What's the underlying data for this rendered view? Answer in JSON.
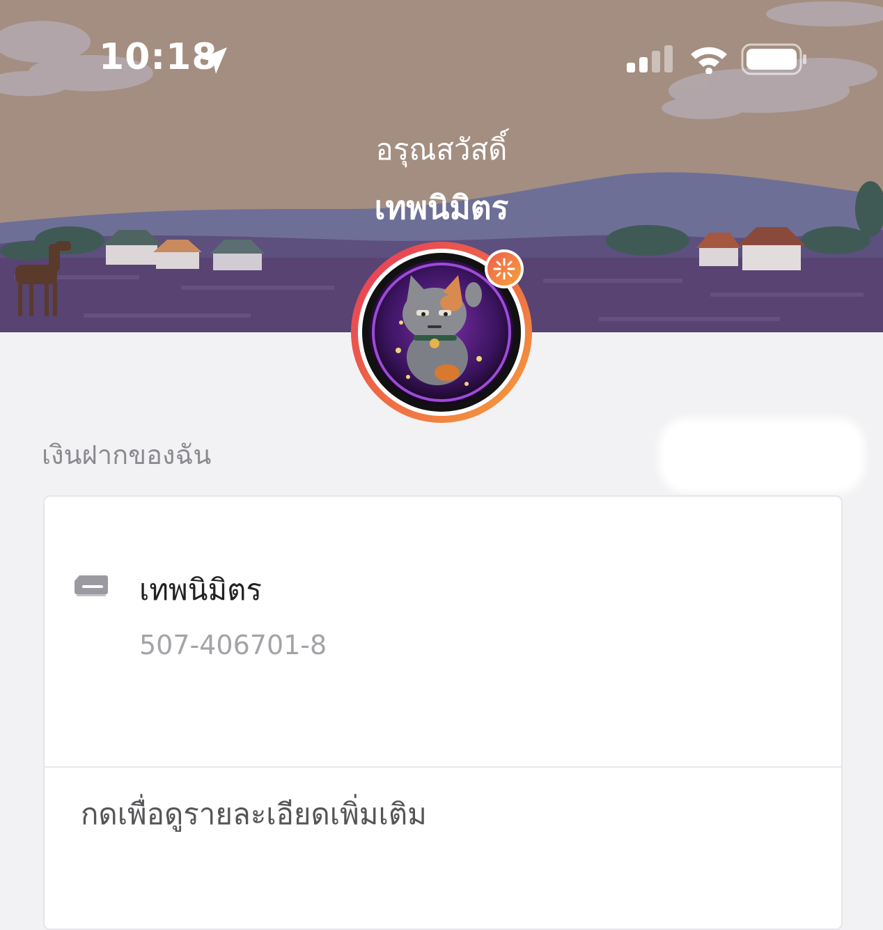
{
  "status_bar": {
    "time": "10:18",
    "icons": [
      "location-arrow-icon",
      "cellular-signal-icon",
      "wifi-icon",
      "battery-icon"
    ]
  },
  "header": {
    "greeting": "อรุณสวัสดิ์",
    "user_name": "เทพนิมิตร",
    "avatar": "lucky-cat-avatar",
    "avatar_badge_icon": "sparkle-badge-icon"
  },
  "section": {
    "title": "เงินฝากของฉัน"
  },
  "account_card": {
    "icon": "bank-card-icon",
    "account_name": "เทพนิมิตร",
    "account_number": "507-406701-8",
    "more_details_label": "กดเพื่อดูรายละเอียดเพิ่มเติม"
  },
  "colors": {
    "header_sky": "#a08d80",
    "avatar_ring_start": "#e6385a",
    "avatar_ring_end": "#f2a23c",
    "background": "#f2f2f4",
    "card": "#ffffff"
  }
}
